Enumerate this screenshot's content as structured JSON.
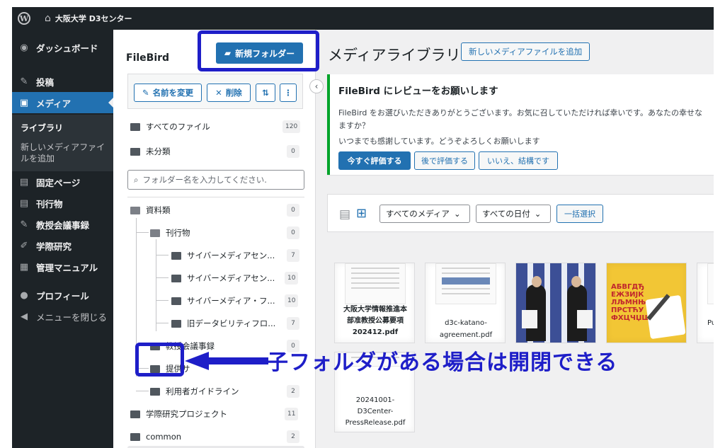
{
  "admin_bar": {
    "site_name": "大阪大学 D3センター"
  },
  "sidebar": {
    "items": [
      {
        "label": "ダッシュボード",
        "icon": "dashboard-icon"
      },
      {
        "label": "投稿",
        "icon": "pin-icon"
      },
      {
        "label": "メディア",
        "icon": "media-icon"
      },
      {
        "label": "固定ページ",
        "icon": "page-icon"
      },
      {
        "label": "刊行物",
        "icon": "page-icon"
      },
      {
        "label": "教授会議事録",
        "icon": "pin-icon"
      },
      {
        "label": "学際研究",
        "icon": "pencil-icon"
      },
      {
        "label": "管理マニュアル",
        "icon": "doc-icon"
      },
      {
        "label": "プロフィール",
        "icon": "user-icon"
      },
      {
        "label": "メニューを閉じる",
        "icon": "collapse-icon"
      }
    ],
    "submenu": {
      "library": "ライブラリ",
      "add_new": "新しいメディアファイルを追加"
    }
  },
  "filebird": {
    "title": "FileBird",
    "new_folder": "新規フォルダー",
    "rename": "名前を変更",
    "delete": "削除",
    "sort_icon": "sort-icon",
    "more": "⋮",
    "all_files": {
      "label": "すべてのファイル",
      "count": "120"
    },
    "uncategorized": {
      "label": "未分類",
      "count": "0"
    },
    "search_placeholder": "フォルダー名を入力してください.",
    "tree": [
      {
        "label": "資料類",
        "count": "0"
      },
      {
        "label": "刊行物",
        "count": "0"
      },
      {
        "label": "サイバーメディアセン...",
        "count": "7"
      },
      {
        "label": "サイバーメディアセン...",
        "count": "10"
      },
      {
        "label": "サイバーメディア・フ...",
        "count": "10"
      },
      {
        "label": "旧データビリティフロ...",
        "count": "7"
      },
      {
        "label": "教授会議事録",
        "count": "0"
      },
      {
        "label": "提供サ",
        "count": ""
      },
      {
        "label": "利用者ガイドライン",
        "count": "2"
      },
      {
        "label": "学際研究プロジェクト",
        "count": "11"
      },
      {
        "label": "common",
        "count": "2"
      }
    ]
  },
  "main": {
    "title": "メディアライブラリ",
    "add_new": "新しいメディアファイルを追加",
    "notice": {
      "heading": "FileBird にレビューをお願いします",
      "text1": "FileBird をお選びいただきありがとうございます。お気に召していただければ幸いです。あなたの幸せな",
      "text1b": "ますか？",
      "text2": "いつまでも感謝しています。どうぞよろしくお願いします",
      "btn_rate": "今すぐ評価する",
      "btn_later": "後で評価する",
      "btn_no": "いいえ、結構です"
    },
    "filter": {
      "all_media": "すべてのメディア",
      "all_dates": "すべての日付",
      "bulk_select": "一括選択"
    },
    "tiles": [
      {
        "caption": "大阪大学情報推進本部准教授公募要項202412.pdf"
      },
      {
        "caption": "d3c-katano-agreement.pdf"
      },
      {
        "caption": ""
      },
      {
        "caption": ""
      },
      {
        "caption": "Pu ap"
      },
      {
        "caption": "20241001-D3Center-PressRelease.pdf"
      }
    ]
  },
  "annotation": {
    "text": "子フォルダがある場合は開閉できる",
    "color": "#1e1ec8"
  }
}
